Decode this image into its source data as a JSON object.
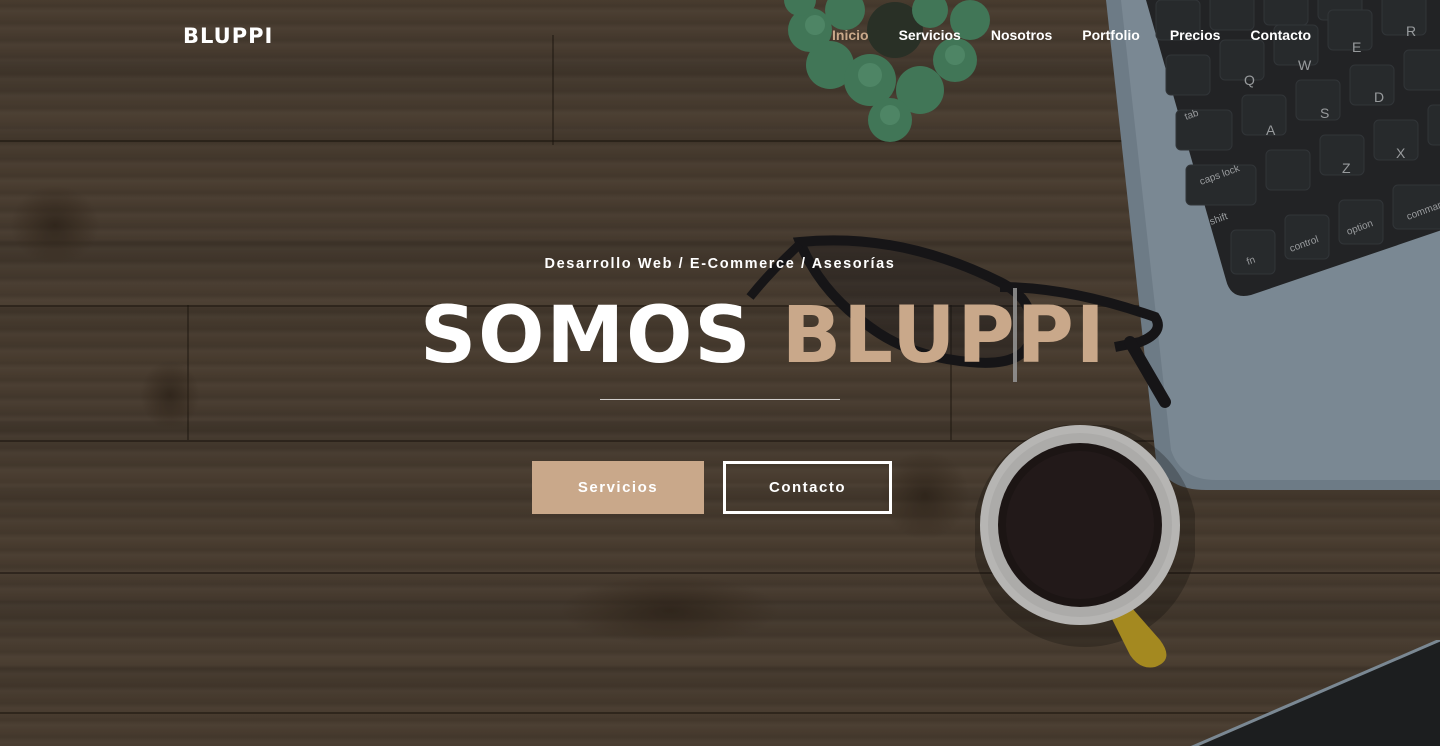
{
  "header": {
    "logo": "BLUPPI",
    "nav": [
      {
        "label": "Inicio",
        "active": true
      },
      {
        "label": "Servicios",
        "active": false
      },
      {
        "label": "Nosotros",
        "active": false
      },
      {
        "label": "Portfolio",
        "active": false
      },
      {
        "label": "Precios",
        "active": false
      },
      {
        "label": "Contacto",
        "active": false
      }
    ]
  },
  "hero": {
    "subtitle": "Desarrollo Web / E-Commerce / Asesorías",
    "headline_prefix": "SOMOS ",
    "headline_accent": "BLUPPI",
    "buttons": {
      "primary": "Servicios",
      "secondary": "Contacto"
    }
  },
  "keyboard_keys": [
    "Q",
    "W",
    "E",
    "R",
    "A",
    "S",
    "D",
    "Z",
    "X",
    "tab",
    "caps lock",
    "shift",
    "fn",
    "control",
    "alt option",
    "⌘ command"
  ],
  "colors": {
    "accent": "#c9a88a",
    "text": "#ffffff"
  },
  "icons": {
    "background": "wood-desk-photo",
    "decor": [
      "plant-icon",
      "laptop-icon",
      "glasses-icon",
      "coffee-cup-icon"
    ]
  }
}
